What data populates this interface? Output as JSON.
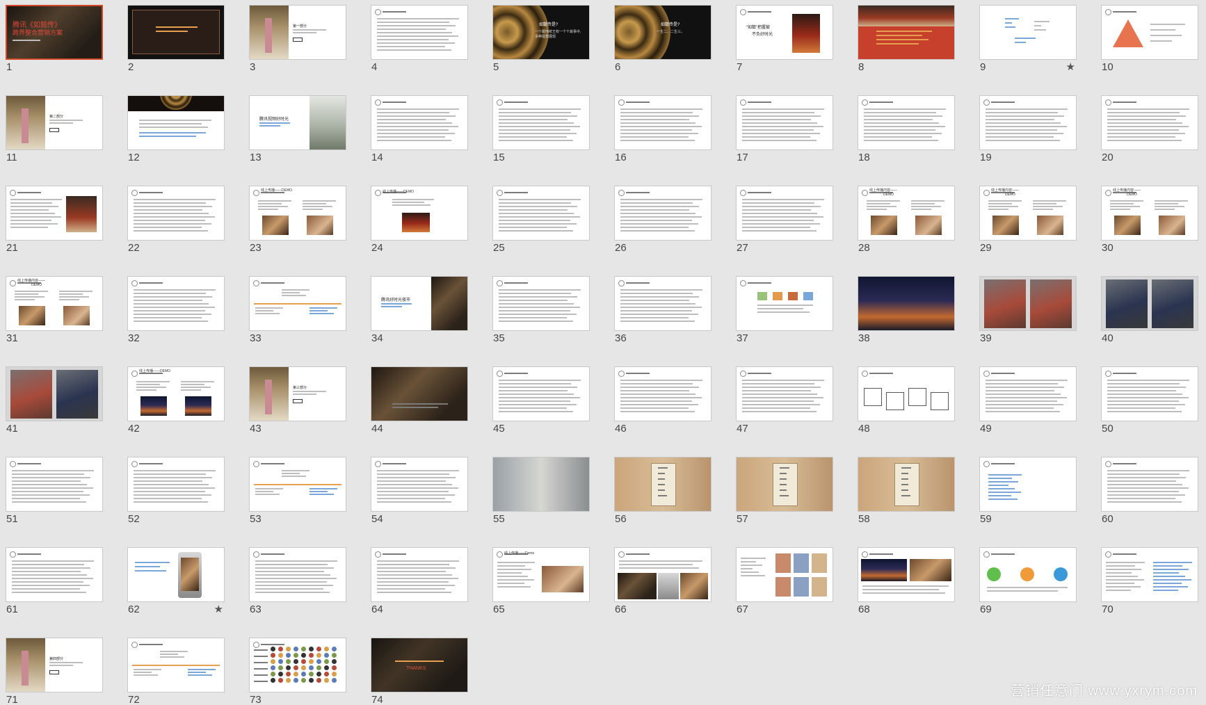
{
  "app": {
    "view": "slide-sorter",
    "selected_slide": 1,
    "accent_color": "#d24726"
  },
  "slides": [
    {
      "number": "1",
      "starred": false,
      "text": [
        "腾讯《如懿传》",
        "跨界整合营销方案"
      ]
    },
    {
      "number": "2",
      "starred": false,
      "text": []
    },
    {
      "number": "3",
      "starred": false,
      "text": [
        "第一部分"
      ]
    },
    {
      "number": "4",
      "starred": false,
      "text": []
    },
    {
      "number": "5",
      "starred": false,
      "text": [
        "如懿传是?",
        "一个跟传统王权一个个故事中,",
        "多种视角展现"
      ]
    },
    {
      "number": "6",
      "starred": false,
      "text": [
        "如懿传是?",
        "一生二、二生三。"
      ]
    },
    {
      "number": "7",
      "starred": false,
      "text": [
        "“如懿”把握被",
        "不负好时光"
      ]
    },
    {
      "number": "8",
      "starred": false,
      "text": []
    },
    {
      "number": "9",
      "starred": true,
      "text": []
    },
    {
      "number": "10",
      "starred": false,
      "text": []
    },
    {
      "number": "11",
      "starred": false,
      "text": [
        "第二部分"
      ]
    },
    {
      "number": "12",
      "starred": false,
      "text": []
    },
    {
      "number": "13",
      "starred": false,
      "text": [
        "腾讯视频好时光"
      ]
    },
    {
      "number": "14",
      "starred": false,
      "text": []
    },
    {
      "number": "15",
      "starred": false,
      "text": []
    },
    {
      "number": "16",
      "starred": false,
      "text": []
    },
    {
      "number": "17",
      "starred": false,
      "text": []
    },
    {
      "number": "18",
      "starred": false,
      "text": []
    },
    {
      "number": "19",
      "starred": false,
      "text": []
    },
    {
      "number": "20",
      "starred": false,
      "text": []
    },
    {
      "number": "21",
      "starred": false,
      "text": []
    },
    {
      "number": "22",
      "starred": false,
      "text": []
    },
    {
      "number": "23",
      "starred": false,
      "text": [
        "线上传播——DEMO"
      ]
    },
    {
      "number": "24",
      "starred": false,
      "text": [
        "线上传播——DEMO"
      ]
    },
    {
      "number": "25",
      "starred": false,
      "text": []
    },
    {
      "number": "26",
      "starred": false,
      "text": []
    },
    {
      "number": "27",
      "starred": false,
      "text": []
    },
    {
      "number": "28",
      "starred": false,
      "text": [
        "线上传播内容——",
        "DEMO"
      ]
    },
    {
      "number": "29",
      "starred": false,
      "text": [
        "线上传播内容——",
        "DEMO"
      ]
    },
    {
      "number": "30",
      "starred": false,
      "text": [
        "线上传播内容——",
        "DEMO"
      ]
    },
    {
      "number": "31",
      "starred": false,
      "text": [
        "线上传播内容——",
        "DEMO"
      ]
    },
    {
      "number": "32",
      "starred": false,
      "text": []
    },
    {
      "number": "33",
      "starred": false,
      "text": []
    },
    {
      "number": "34",
      "starred": false,
      "text": [
        "腾讯好时光夜市"
      ]
    },
    {
      "number": "35",
      "starred": false,
      "text": []
    },
    {
      "number": "36",
      "starred": false,
      "text": []
    },
    {
      "number": "37",
      "starred": false,
      "text": []
    },
    {
      "number": "38",
      "starred": false,
      "text": []
    },
    {
      "number": "39",
      "starred": false,
      "text": []
    },
    {
      "number": "40",
      "starred": false,
      "text": []
    },
    {
      "number": "41",
      "starred": false,
      "text": []
    },
    {
      "number": "42",
      "starred": false,
      "text": [
        "线上传播——DEMO"
      ]
    },
    {
      "number": "43",
      "starred": false,
      "text": [
        "第三部分"
      ]
    },
    {
      "number": "44",
      "starred": false,
      "text": []
    },
    {
      "number": "45",
      "starred": false,
      "text": []
    },
    {
      "number": "46",
      "starred": false,
      "text": []
    },
    {
      "number": "47",
      "starred": false,
      "text": []
    },
    {
      "number": "48",
      "starred": false,
      "text": []
    },
    {
      "number": "49",
      "starred": false,
      "text": []
    },
    {
      "number": "50",
      "starred": false,
      "text": []
    },
    {
      "number": "51",
      "starred": false,
      "text": []
    },
    {
      "number": "52",
      "starred": false,
      "text": []
    },
    {
      "number": "53",
      "starred": false,
      "text": []
    },
    {
      "number": "54",
      "starred": false,
      "text": []
    },
    {
      "number": "55",
      "starred": false,
      "text": []
    },
    {
      "number": "56",
      "starred": false,
      "text": []
    },
    {
      "number": "57",
      "starred": false,
      "text": []
    },
    {
      "number": "58",
      "starred": false,
      "text": []
    },
    {
      "number": "59",
      "starred": false,
      "text": []
    },
    {
      "number": "60",
      "starred": false,
      "text": []
    },
    {
      "number": "61",
      "starred": false,
      "text": []
    },
    {
      "number": "62",
      "starred": true,
      "text": []
    },
    {
      "number": "63",
      "starred": false,
      "text": []
    },
    {
      "number": "64",
      "starred": false,
      "text": []
    },
    {
      "number": "65",
      "starred": false,
      "text": [
        "线上传播——Demo"
      ]
    },
    {
      "number": "66",
      "starred": false,
      "text": []
    },
    {
      "number": "67",
      "starred": false,
      "text": []
    },
    {
      "number": "68",
      "starred": false,
      "text": []
    },
    {
      "number": "69",
      "starred": false,
      "text": []
    },
    {
      "number": "70",
      "starred": false,
      "text": []
    },
    {
      "number": "71",
      "starred": false,
      "text": [
        "第四部分"
      ]
    },
    {
      "number": "72",
      "starred": false,
      "text": []
    },
    {
      "number": "73",
      "starred": false,
      "text": []
    },
    {
      "number": "74",
      "starred": false,
      "text": [
        "THANKS"
      ]
    }
  ],
  "star_glyph": "★",
  "watermark": "营销任意门 www.yxrym.com"
}
